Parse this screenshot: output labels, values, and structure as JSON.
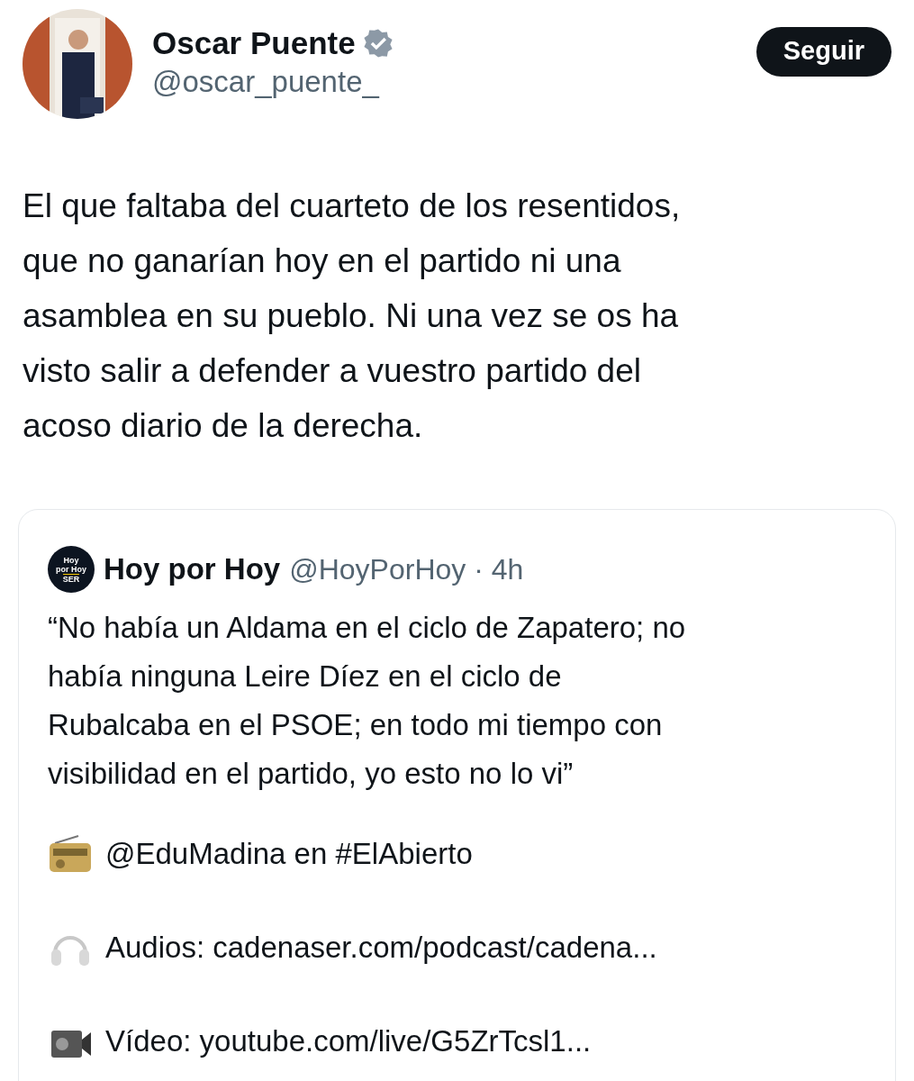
{
  "author": {
    "name": "Oscar Puente",
    "verified": true,
    "handle": "@oscar_puente_"
  },
  "follow_button": "Seguir",
  "post": {
    "lines": [
      "El que faltaba del cuarteto de los resentidos,",
      "que no ganarían hoy en el partido ni una",
      "asamblea en su pueblo. Ni una vez se os ha",
      "visto salir a defender a vuestro partido del",
      "acoso diario de la derecha."
    ]
  },
  "quoted_post": {
    "logo": [
      "Hoy",
      "por Hoy",
      "SER"
    ],
    "name": "Hoy por Hoy",
    "handle": "@HoyPorHoy",
    "separator": "·",
    "time": "4h",
    "lines": [
      "“No había un Aldama en el ciclo de Zapatero; no",
      "había ninguna Leire Díez en el ciclo de",
      "Rubalcaba en el PSOE; en todo mi tiempo con",
      "visibilidad en el partido, yo esto no lo vi”"
    ],
    "items": [
      {
        "kind": "radio",
        "text": "@EduMadina en #ElAbierto"
      },
      {
        "kind": "headphones",
        "text": "Audios: cadenaser.com/podcast/cadena..."
      },
      {
        "kind": "camcorder",
        "text": "Vídeo: youtube.com/live/G5ZrTcsl1..."
      }
    ]
  }
}
